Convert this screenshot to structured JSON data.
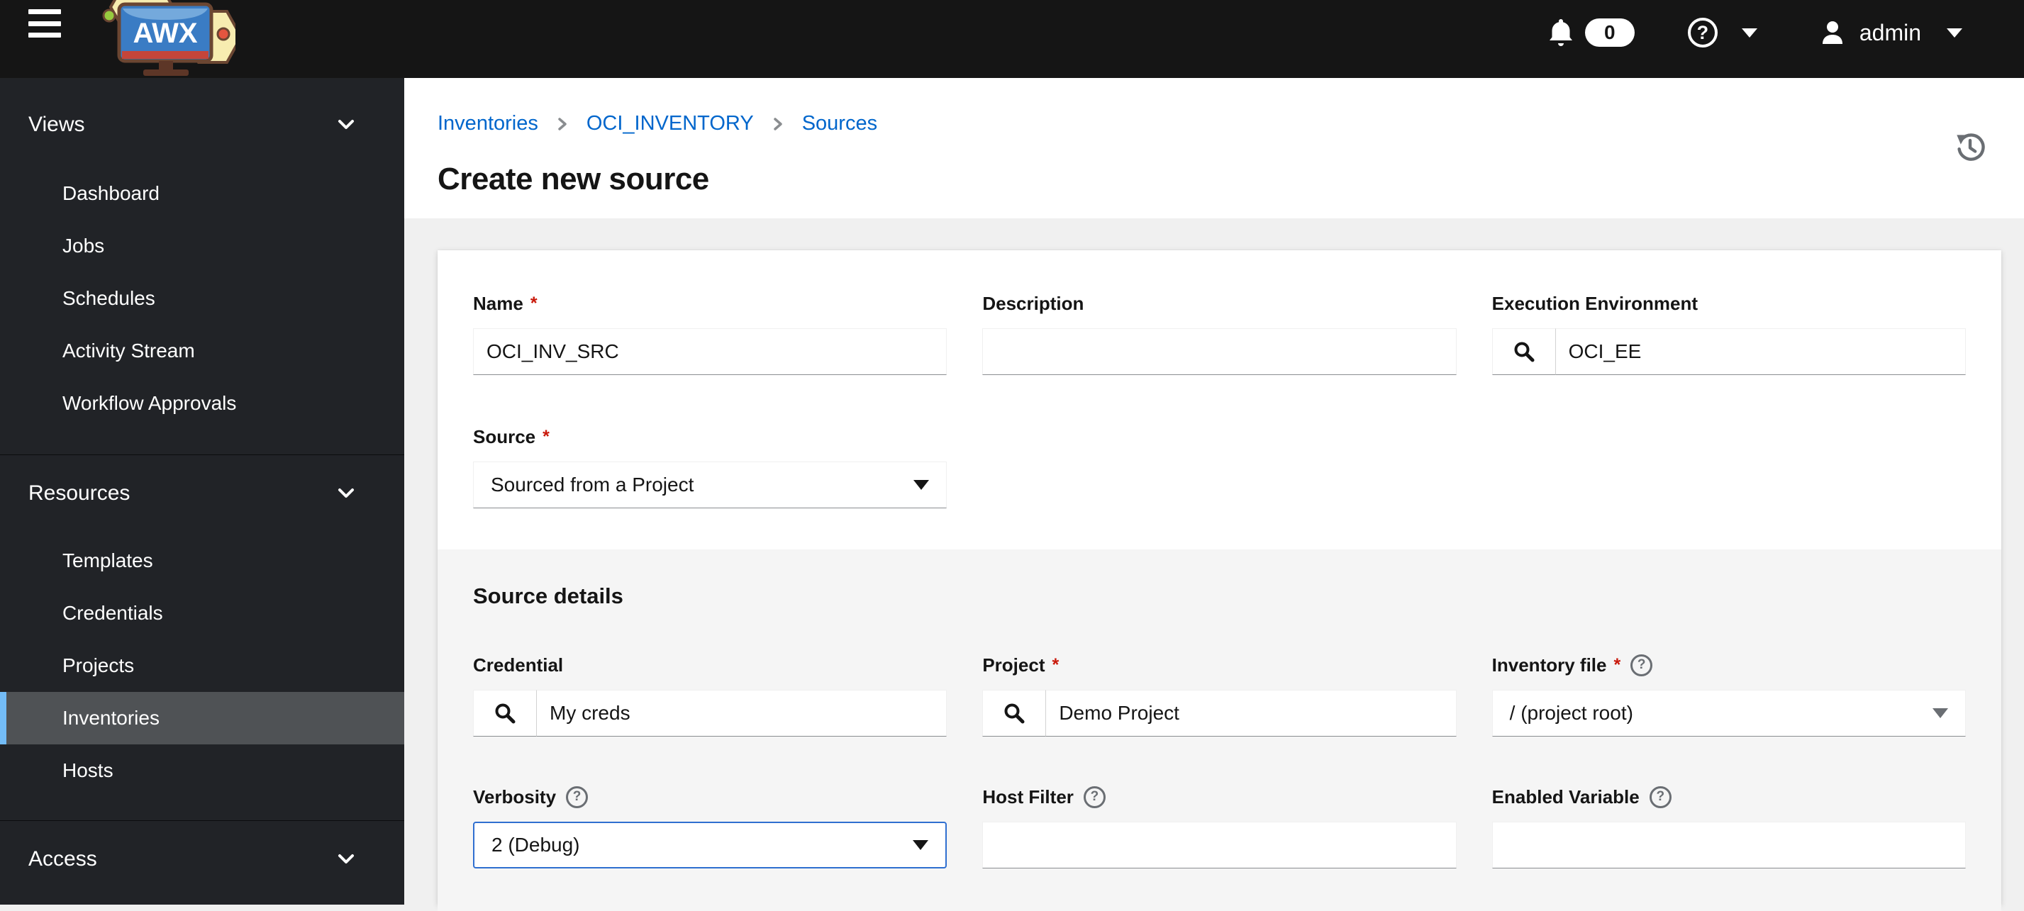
{
  "masthead": {
    "logo_text": "AWX",
    "notifications_count": "0",
    "user_name": "admin"
  },
  "sidebar": {
    "groups": [
      {
        "label": "Views",
        "items": [
          {
            "label": "Dashboard"
          },
          {
            "label": "Jobs"
          },
          {
            "label": "Schedules"
          },
          {
            "label": "Activity Stream"
          },
          {
            "label": "Workflow Approvals"
          }
        ]
      },
      {
        "label": "Resources",
        "items": [
          {
            "label": "Templates"
          },
          {
            "label": "Credentials"
          },
          {
            "label": "Projects"
          },
          {
            "label": "Inventories",
            "selected": true
          },
          {
            "label": "Hosts"
          }
        ]
      },
      {
        "label": "Access",
        "items": []
      }
    ]
  },
  "header": {
    "breadcrumbs": [
      {
        "label": "Inventories"
      },
      {
        "label": "OCI_INVENTORY"
      },
      {
        "label": "Sources"
      }
    ],
    "title": "Create new source"
  },
  "form": {
    "required_marker": "*",
    "help_marker": "?",
    "name": {
      "label": "Name",
      "value": "OCI_INV_SRC"
    },
    "description": {
      "label": "Description",
      "value": ""
    },
    "execution_environment": {
      "label": "Execution Environment",
      "value": "OCI_EE"
    },
    "source": {
      "label": "Source",
      "value": "Sourced from a Project"
    },
    "source_details": {
      "heading": "Source details",
      "credential": {
        "label": "Credential",
        "value": "My creds"
      },
      "project": {
        "label": "Project",
        "value": "Demo Project"
      },
      "inventory_file": {
        "label": "Inventory file",
        "value": "/ (project root)"
      },
      "verbosity": {
        "label": "Verbosity",
        "value": "2 (Debug)"
      },
      "host_filter": {
        "label": "Host Filter",
        "value": ""
      },
      "enabled_variable": {
        "label": "Enabled Variable",
        "value": ""
      }
    }
  },
  "colors": {
    "masthead_bg": "#151515",
    "sidebar_bg": "#212327",
    "selected_item_bg": "#4f5255",
    "selected_accent": "#73bcf7",
    "link_blue": "#0066cc",
    "required_red": "#c9190b",
    "focus_blue": "#2f6fd0",
    "page_bg": "#f0f0f0",
    "subform_bg": "#f5f5f5"
  }
}
